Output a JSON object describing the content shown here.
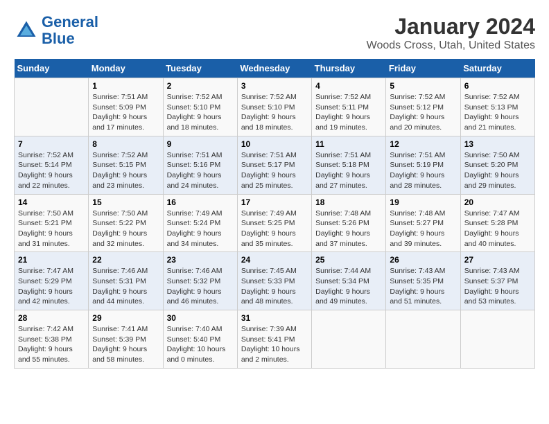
{
  "header": {
    "logo_line1": "General",
    "logo_line2": "Blue",
    "title": "January 2024",
    "subtitle": "Woods Cross, Utah, United States"
  },
  "calendar": {
    "days_of_week": [
      "Sunday",
      "Monday",
      "Tuesday",
      "Wednesday",
      "Thursday",
      "Friday",
      "Saturday"
    ],
    "weeks": [
      [
        {
          "day": "",
          "info": ""
        },
        {
          "day": "1",
          "info": "Sunrise: 7:51 AM\nSunset: 5:09 PM\nDaylight: 9 hours\nand 17 minutes."
        },
        {
          "day": "2",
          "info": "Sunrise: 7:52 AM\nSunset: 5:10 PM\nDaylight: 9 hours\nand 18 minutes."
        },
        {
          "day": "3",
          "info": "Sunrise: 7:52 AM\nSunset: 5:10 PM\nDaylight: 9 hours\nand 18 minutes."
        },
        {
          "day": "4",
          "info": "Sunrise: 7:52 AM\nSunset: 5:11 PM\nDaylight: 9 hours\nand 19 minutes."
        },
        {
          "day": "5",
          "info": "Sunrise: 7:52 AM\nSunset: 5:12 PM\nDaylight: 9 hours\nand 20 minutes."
        },
        {
          "day": "6",
          "info": "Sunrise: 7:52 AM\nSunset: 5:13 PM\nDaylight: 9 hours\nand 21 minutes."
        }
      ],
      [
        {
          "day": "7",
          "info": "Sunrise: 7:52 AM\nSunset: 5:14 PM\nDaylight: 9 hours\nand 22 minutes."
        },
        {
          "day": "8",
          "info": "Sunrise: 7:52 AM\nSunset: 5:15 PM\nDaylight: 9 hours\nand 23 minutes."
        },
        {
          "day": "9",
          "info": "Sunrise: 7:51 AM\nSunset: 5:16 PM\nDaylight: 9 hours\nand 24 minutes."
        },
        {
          "day": "10",
          "info": "Sunrise: 7:51 AM\nSunset: 5:17 PM\nDaylight: 9 hours\nand 25 minutes."
        },
        {
          "day": "11",
          "info": "Sunrise: 7:51 AM\nSunset: 5:18 PM\nDaylight: 9 hours\nand 27 minutes."
        },
        {
          "day": "12",
          "info": "Sunrise: 7:51 AM\nSunset: 5:19 PM\nDaylight: 9 hours\nand 28 minutes."
        },
        {
          "day": "13",
          "info": "Sunrise: 7:50 AM\nSunset: 5:20 PM\nDaylight: 9 hours\nand 29 minutes."
        }
      ],
      [
        {
          "day": "14",
          "info": "Sunrise: 7:50 AM\nSunset: 5:21 PM\nDaylight: 9 hours\nand 31 minutes."
        },
        {
          "day": "15",
          "info": "Sunrise: 7:50 AM\nSunset: 5:22 PM\nDaylight: 9 hours\nand 32 minutes."
        },
        {
          "day": "16",
          "info": "Sunrise: 7:49 AM\nSunset: 5:24 PM\nDaylight: 9 hours\nand 34 minutes."
        },
        {
          "day": "17",
          "info": "Sunrise: 7:49 AM\nSunset: 5:25 PM\nDaylight: 9 hours\nand 35 minutes."
        },
        {
          "day": "18",
          "info": "Sunrise: 7:48 AM\nSunset: 5:26 PM\nDaylight: 9 hours\nand 37 minutes."
        },
        {
          "day": "19",
          "info": "Sunrise: 7:48 AM\nSunset: 5:27 PM\nDaylight: 9 hours\nand 39 minutes."
        },
        {
          "day": "20",
          "info": "Sunrise: 7:47 AM\nSunset: 5:28 PM\nDaylight: 9 hours\nand 40 minutes."
        }
      ],
      [
        {
          "day": "21",
          "info": "Sunrise: 7:47 AM\nSunset: 5:29 PM\nDaylight: 9 hours\nand 42 minutes."
        },
        {
          "day": "22",
          "info": "Sunrise: 7:46 AM\nSunset: 5:31 PM\nDaylight: 9 hours\nand 44 minutes."
        },
        {
          "day": "23",
          "info": "Sunrise: 7:46 AM\nSunset: 5:32 PM\nDaylight: 9 hours\nand 46 minutes."
        },
        {
          "day": "24",
          "info": "Sunrise: 7:45 AM\nSunset: 5:33 PM\nDaylight: 9 hours\nand 48 minutes."
        },
        {
          "day": "25",
          "info": "Sunrise: 7:44 AM\nSunset: 5:34 PM\nDaylight: 9 hours\nand 49 minutes."
        },
        {
          "day": "26",
          "info": "Sunrise: 7:43 AM\nSunset: 5:35 PM\nDaylight: 9 hours\nand 51 minutes."
        },
        {
          "day": "27",
          "info": "Sunrise: 7:43 AM\nSunset: 5:37 PM\nDaylight: 9 hours\nand 53 minutes."
        }
      ],
      [
        {
          "day": "28",
          "info": "Sunrise: 7:42 AM\nSunset: 5:38 PM\nDaylight: 9 hours\nand 55 minutes."
        },
        {
          "day": "29",
          "info": "Sunrise: 7:41 AM\nSunset: 5:39 PM\nDaylight: 9 hours\nand 58 minutes."
        },
        {
          "day": "30",
          "info": "Sunrise: 7:40 AM\nSunset: 5:40 PM\nDaylight: 10 hours\nand 0 minutes."
        },
        {
          "day": "31",
          "info": "Sunrise: 7:39 AM\nSunset: 5:41 PM\nDaylight: 10 hours\nand 2 minutes."
        },
        {
          "day": "",
          "info": ""
        },
        {
          "day": "",
          "info": ""
        },
        {
          "day": "",
          "info": ""
        }
      ]
    ]
  }
}
